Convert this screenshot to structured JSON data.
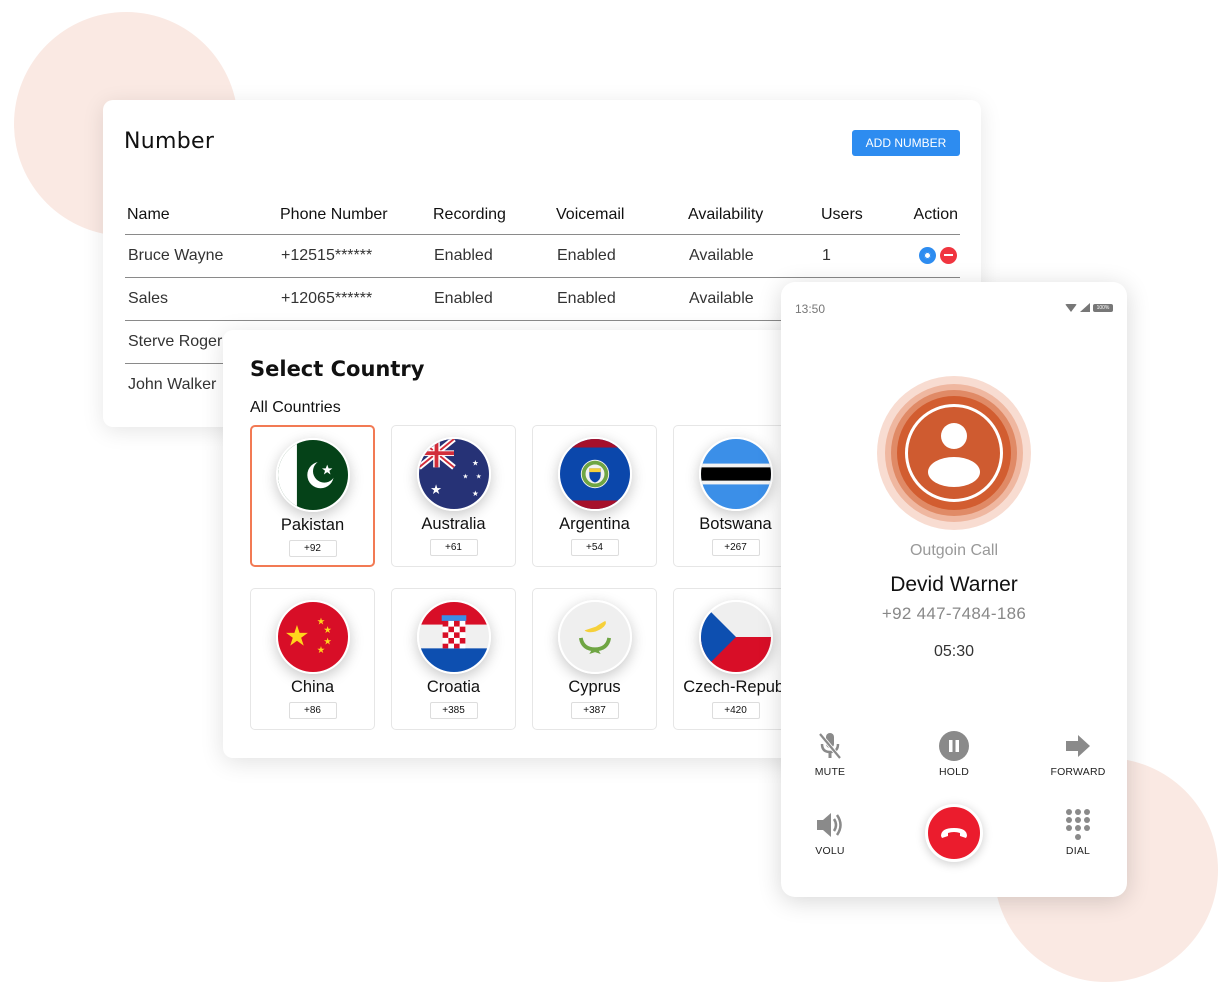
{
  "colors": {
    "accent": "#2d8cf0",
    "danger": "#f0353f",
    "selected_border": "#f27a54",
    "avatar": "#cf5b30",
    "hangup": "#eb1c2d",
    "background_circle": "#fae9e3"
  },
  "number_panel": {
    "title": "Number",
    "add_button": "ADD NUMBER",
    "columns": [
      "Name",
      "Phone Number",
      "Recording",
      "Voicemail",
      "Availability",
      "Users",
      "Action"
    ],
    "rows": [
      {
        "name": "Bruce Wayne",
        "phone": "+12515******",
        "recording": "Enabled",
        "voicemail": "Enabled",
        "availability": "Available",
        "users": "1",
        "actions": [
          "settings-icon",
          "remove-icon"
        ]
      },
      {
        "name": "Sales",
        "phone": "+12065******",
        "recording": "Enabled",
        "voicemail": "Enabled",
        "availability": "Available",
        "users": "",
        "actions": []
      },
      {
        "name": "Sterve Roger",
        "phone": "",
        "recording": "",
        "voicemail": "",
        "availability": "",
        "users": "",
        "actions": []
      },
      {
        "name": "John Walker",
        "phone": "",
        "recording": "",
        "voicemail": "",
        "availability": "",
        "users": "",
        "actions": []
      }
    ]
  },
  "country_panel": {
    "title": "Select Country",
    "subtitle": "All Countries",
    "selected": "Pakistan",
    "countries": [
      {
        "name": "Pakistan",
        "code": "+92",
        "flag": "pakistan-flag-icon"
      },
      {
        "name": "Australia",
        "code": "+61",
        "flag": "australia-flag-icon"
      },
      {
        "name": "Argentina",
        "code": "+54",
        "flag": "belize-style-flag-icon"
      },
      {
        "name": "Botswana",
        "code": "+267",
        "flag": "botswana-flag-icon"
      },
      {
        "name": "China",
        "code": "+86",
        "flag": "china-flag-icon"
      },
      {
        "name": "Croatia",
        "code": "+385",
        "flag": "croatia-flag-icon"
      },
      {
        "name": "Cyprus",
        "code": "+387",
        "flag": "cyprus-flag-icon"
      },
      {
        "name": "Czech-Republ",
        "code": "+420",
        "flag": "czech-flag-icon"
      }
    ]
  },
  "phone": {
    "status_time": "13:50",
    "battery": "100%",
    "call_status": "Outgoin Call",
    "caller_name": "Devid Warner",
    "caller_number": "+92 447-7484-186",
    "timer": "05:30",
    "controls": {
      "mute": "MUTE",
      "hold": "HOLD",
      "forward": "FORWARD",
      "volume": "VOLU",
      "dial": "DIAL"
    }
  }
}
